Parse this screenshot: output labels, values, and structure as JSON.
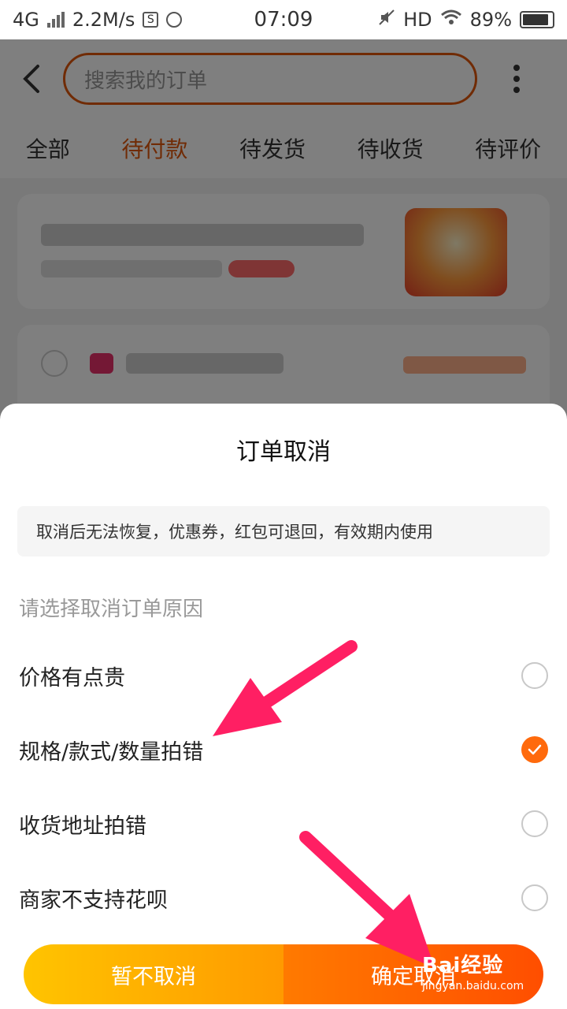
{
  "status_bar": {
    "network": "4G",
    "speed": "2.2M/s",
    "time": "07:09",
    "hd": "HD",
    "battery": "89%"
  },
  "header": {
    "search_placeholder": "搜索我的订单",
    "back_icon": "chevron-left-icon",
    "more_icon": "more-vertical-icon"
  },
  "tabs": [
    {
      "label": "全部",
      "active": false
    },
    {
      "label": "待付款",
      "active": true
    },
    {
      "label": "待发货",
      "active": false
    },
    {
      "label": "待收货",
      "active": false
    },
    {
      "label": "待评价",
      "active": false
    }
  ],
  "sheet": {
    "title": "订单取消",
    "notice": "取消后无法恢复，优惠券，红包可退回，有效期内使用",
    "prompt": "请选择取消订单原因",
    "reasons": [
      {
        "label": "价格有点贵",
        "checked": false
      },
      {
        "label": "规格/款式/数量拍错",
        "checked": true
      },
      {
        "label": "收货地址拍错",
        "checked": false
      },
      {
        "label": "商家不支持花呗",
        "checked": false
      }
    ],
    "keep_label": "暂不取消",
    "confirm_label": "确定取消"
  },
  "colors": {
    "accent": "#e0560a",
    "checked": "#ff6a0c",
    "arrow": "#ff1f63"
  },
  "watermark": {
    "logo": "Bai经验",
    "url": "jingyan.baidu.com"
  }
}
